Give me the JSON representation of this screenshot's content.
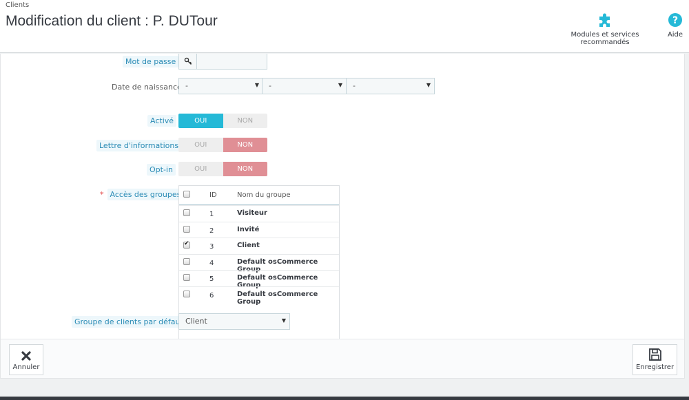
{
  "header": {
    "breadcrumb": "Clients",
    "title": "Modification du client : P. DUTour",
    "modules_label": "Modules et services recommandés",
    "help_label": "Aide"
  },
  "form": {
    "password_label": "Mot de passe",
    "birthdate_label": "Date de naissance",
    "birthdate": {
      "day": "-",
      "month": "-",
      "year": "-"
    },
    "active_label": "Activé",
    "newsletter_label": "Lettre d'informations",
    "optin_label": "Opt-in",
    "yes": "OUI",
    "no": "NON",
    "active": true,
    "newsletter": false,
    "optin": false,
    "groups_label": "Accès des groupes",
    "groups_columns": {
      "id": "ID",
      "name": "Nom du groupe"
    },
    "groups": [
      {
        "id": "1",
        "name": "Visiteur",
        "checked": false
      },
      {
        "id": "2",
        "name": "Invité",
        "checked": false
      },
      {
        "id": "3",
        "name": "Client",
        "checked": true
      },
      {
        "id": "4",
        "name": "Default osCommerce Group",
        "checked": false
      },
      {
        "id": "5",
        "name": "Default osCommerce Group",
        "checked": false
      },
      {
        "id": "6",
        "name": "Default osCommerce Group",
        "checked": false
      }
    ],
    "default_group_label": "Groupe de clients par défaut",
    "default_group_value": "Client"
  },
  "footer": {
    "cancel_label": "Annuler",
    "save_label": "Enregistrer"
  },
  "colors": {
    "accent": "#25b9d7",
    "no_active": "#e08f95",
    "label_highlight": "#2a8bb5"
  }
}
